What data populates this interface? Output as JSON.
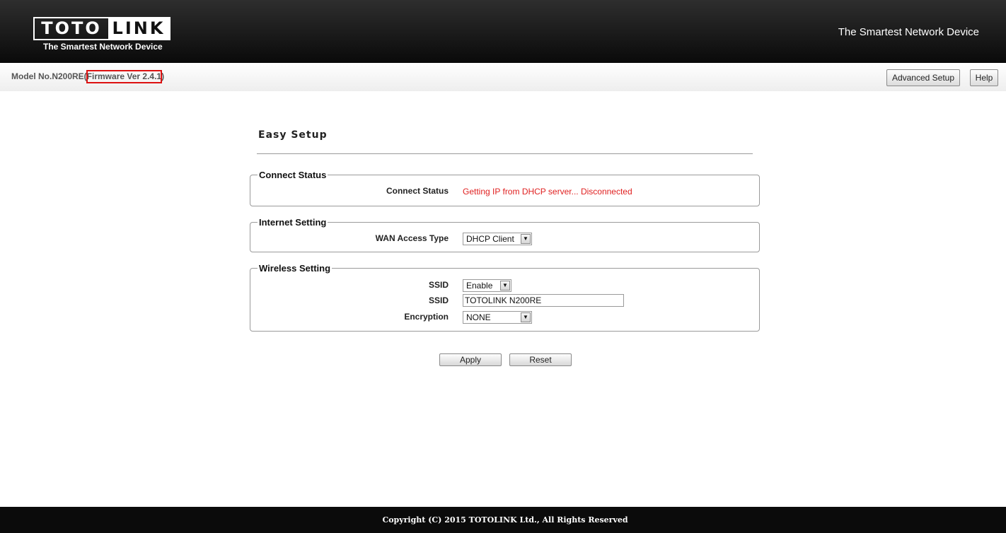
{
  "header": {
    "logo_left": "TOTO",
    "logo_right": "LINK",
    "logo_tagline": "The Smartest Network Device",
    "slogan": "The Smartest Network Device"
  },
  "infobar": {
    "model": "Model No.N200RE(Firmware Ver 2.4.1)",
    "advanced_setup_label": "Advanced Setup",
    "help_label": "Help"
  },
  "page": {
    "title": "Easy Setup"
  },
  "connect_status": {
    "legend": "Connect Status",
    "label": "Connect Status",
    "value": "Getting IP from DHCP server... Disconnected",
    "status_color": "#e02020"
  },
  "internet_setting": {
    "legend": "Internet Setting",
    "wan_label": "WAN Access Type",
    "wan_value": "DHCP Client"
  },
  "wireless_setting": {
    "legend": "Wireless Setting",
    "ssid_toggle_label": "SSID",
    "ssid_toggle_value": "Enable",
    "ssid_label": "SSID",
    "ssid_value": "TOTOLINK N200RE",
    "encryption_label": "Encryption",
    "encryption_value": "NONE"
  },
  "actions": {
    "apply_label": "Apply",
    "reset_label": "Reset"
  },
  "footer": {
    "copyright": "Copyright (C) 2015 TOTOLINK Ltd., All Rights Reserved"
  },
  "icons": {
    "dropdown": "chevron-down-icon"
  }
}
